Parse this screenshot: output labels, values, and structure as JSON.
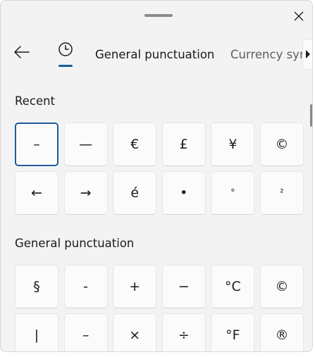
{
  "tabs": {
    "general": "General punctuation",
    "currency": "Currency symb"
  },
  "sections": {
    "recent": {
      "title": "Recent",
      "symbols": [
        "–",
        "—",
        "€",
        "£",
        "¥",
        "©",
        "←",
        "→",
        "é",
        "•",
        "°",
        "²"
      ],
      "selected_index": 0
    },
    "general": {
      "title": "General punctuation",
      "symbols": [
        "§",
        "-",
        "+",
        "−",
        "°C",
        "©",
        "|",
        "–",
        "×",
        "÷",
        "°F",
        "®"
      ]
    }
  },
  "icons": {
    "close": "close-icon",
    "back": "back-arrow-icon",
    "recent": "clock-icon",
    "scroll_right": "chevron-right-icon"
  },
  "colors": {
    "accent": "#1a5e9a",
    "panel_bg": "#f3f3f3",
    "key_bg": "#fbfbfb"
  }
}
